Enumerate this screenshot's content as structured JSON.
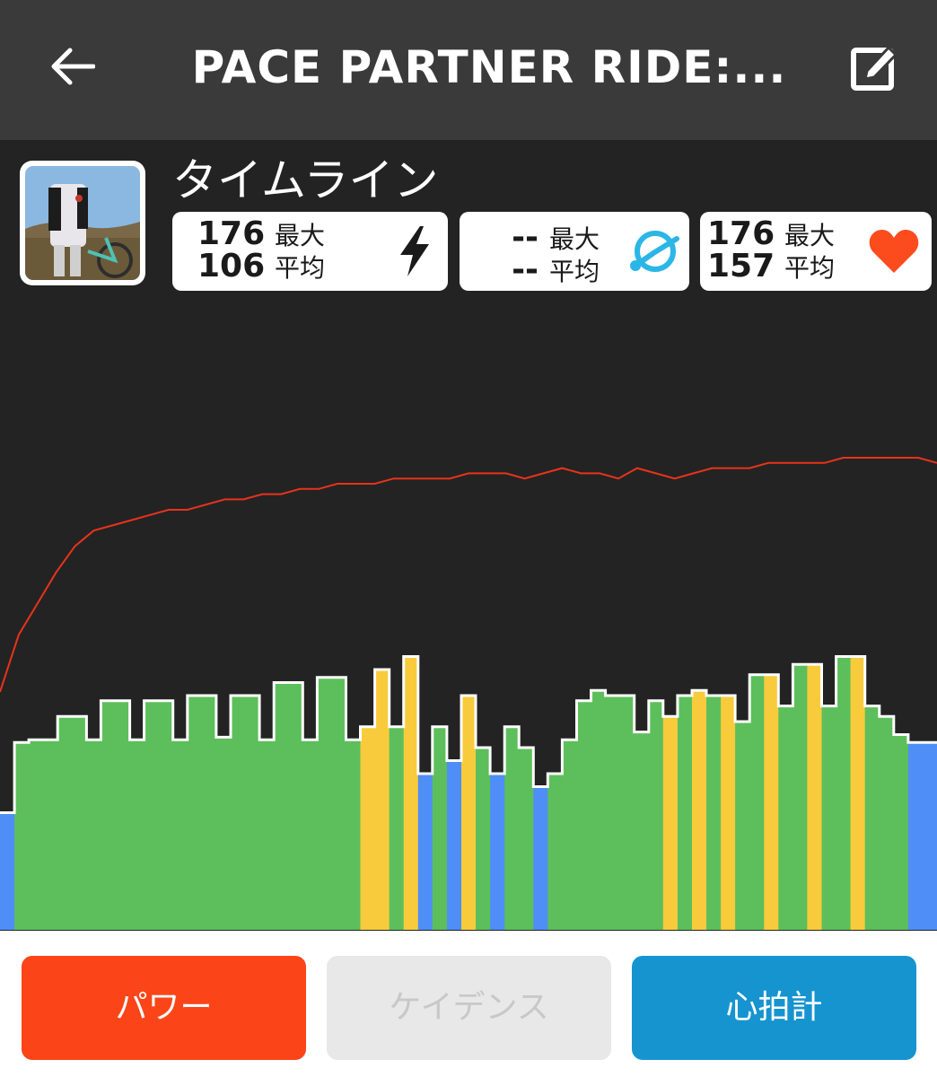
{
  "header": {
    "title": "PACE PARTNER RIDE:...",
    "back_icon": "arrow-left-icon",
    "edit_icon": "edit-icon"
  },
  "section": {
    "title": "タイムライン"
  },
  "stats": {
    "power": {
      "max": "176",
      "max_label": "最大",
      "avg": "106",
      "avg_label": "平均",
      "icon": "lightning-icon"
    },
    "cadence": {
      "max": "--",
      "max_label": "最大",
      "avg": "--",
      "avg_label": "平均",
      "icon": "cadence-icon",
      "color": "#2bb6e6"
    },
    "heart_rate": {
      "max": "176",
      "max_label": "最大",
      "avg": "157",
      "avg_label": "平均",
      "icon": "heart-icon",
      "color": "#fc4c1d"
    }
  },
  "chart_data": {
    "type": "area",
    "series": [
      {
        "kind": "power",
        "values": [
          0.45,
          0.72,
          0.73,
          0.73,
          0.82,
          0.82,
          0.73,
          0.88,
          0.88,
          0.73,
          0.88,
          0.88,
          0.73,
          0.9,
          0.9,
          0.74,
          0.9,
          0.9,
          0.73,
          0.95,
          0.95,
          0.73,
          0.97,
          0.97,
          0.73,
          0.78,
          1.0,
          0.78,
          1.05,
          0.6,
          0.78,
          0.65,
          0.9,
          0.7,
          0.6,
          0.78,
          0.7,
          0.55,
          0.6,
          0.73,
          0.88,
          0.92,
          0.9,
          0.9,
          0.76,
          0.88,
          0.82,
          0.9,
          0.92,
          0.9,
          0.9,
          0.8,
          0.98,
          0.98,
          0.86,
          1.02,
          1.02,
          0.86,
          1.05,
          1.05,
          0.86,
          0.82,
          0.75,
          0.72,
          0.72
        ],
        "zones": [
          "blue",
          "green",
          "green",
          "green",
          "green",
          "green",
          "green",
          "green",
          "green",
          "green",
          "green",
          "green",
          "green",
          "green",
          "green",
          "green",
          "green",
          "green",
          "green",
          "green",
          "green",
          "green",
          "green",
          "green",
          "green",
          "yellow",
          "yellow",
          "green",
          "yellow",
          "blue",
          "green",
          "blue",
          "yellow",
          "green",
          "blue",
          "green",
          "green",
          "blue",
          "green",
          "green",
          "green",
          "green",
          "green",
          "green",
          "green",
          "green",
          "yellow",
          "green",
          "yellow",
          "green",
          "yellow",
          "green",
          "green",
          "yellow",
          "green",
          "green",
          "yellow",
          "green",
          "green",
          "yellow",
          "green",
          "green",
          "green",
          "blue",
          "blue"
        ]
      },
      {
        "kind": "heart_rate",
        "values": [
          0.55,
          0.66,
          0.72,
          0.78,
          0.83,
          0.86,
          0.87,
          0.88,
          0.89,
          0.9,
          0.9,
          0.91,
          0.92,
          0.92,
          0.93,
          0.93,
          0.94,
          0.94,
          0.95,
          0.95,
          0.95,
          0.96,
          0.96,
          0.96,
          0.96,
          0.97,
          0.97,
          0.97,
          0.96,
          0.97,
          0.98,
          0.97,
          0.97,
          0.96,
          0.98,
          0.97,
          0.96,
          0.97,
          0.98,
          0.98,
          0.98,
          0.99,
          0.99,
          0.99,
          0.99,
          1.0,
          1.0,
          1.0,
          1.0,
          1.0,
          0.99
        ]
      }
    ],
    "zone_colors": {
      "blue": "#4f8ef6",
      "green": "#5dbf5b",
      "yellow": "#f8cb3c"
    },
    "heart_rate_color": "#e8331b"
  },
  "modes": [
    {
      "label": "パワー",
      "bg": "#fc4419",
      "fg": "#ffffff"
    },
    {
      "label": "ケイデンス",
      "bg": "#e8e8e8",
      "fg": "#c8c8c8"
    },
    {
      "label": "心拍計",
      "bg": "#1694d0",
      "fg": "#ffffff"
    }
  ]
}
